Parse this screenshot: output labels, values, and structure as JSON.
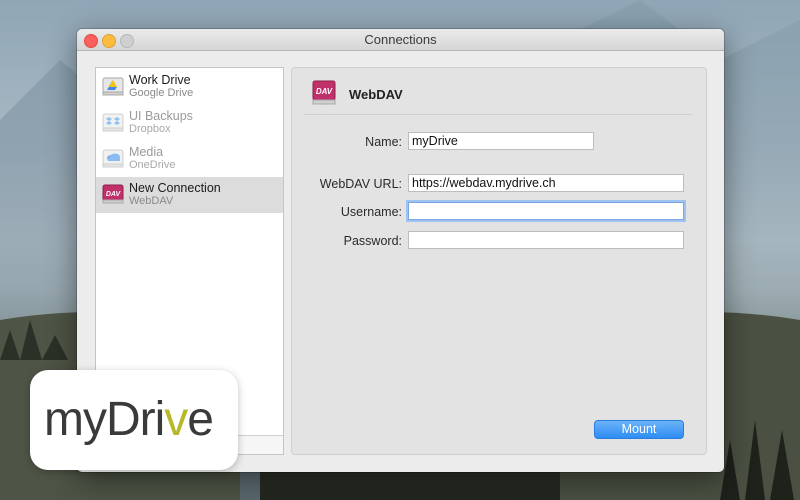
{
  "window": {
    "title": "Connections"
  },
  "sidebar": {
    "items": [
      {
        "name": "Work Drive",
        "type": "Google Drive",
        "icon": "google-drive-icon",
        "state": "normal"
      },
      {
        "name": "UI Backups",
        "type": "Dropbox",
        "icon": "dropbox-icon",
        "state": "dim"
      },
      {
        "name": "Media",
        "type": "OneDrive",
        "icon": "onedrive-icon",
        "state": "dim"
      },
      {
        "name": "New Connection",
        "type": "WebDAV",
        "icon": "webdav-icon",
        "state": "selected"
      }
    ]
  },
  "panel": {
    "title": "WebDAV",
    "icon": "webdav-icon",
    "fields": {
      "name": {
        "label": "Name:",
        "value": "myDrive"
      },
      "url": {
        "label": "WebDAV URL:",
        "value": "https://webdav.mydrive.ch"
      },
      "username": {
        "label": "Username:",
        "value": ""
      },
      "password": {
        "label": "Password:",
        "value": ""
      }
    },
    "mount_label": "Mount"
  },
  "logo": {
    "text_main": "myDri",
    "text_accent": "v",
    "text_end": "e"
  },
  "colors": {
    "accent": "#2d8cf3",
    "webdav_icon": "#c0306a",
    "logo_accent": "#b7b82a"
  }
}
